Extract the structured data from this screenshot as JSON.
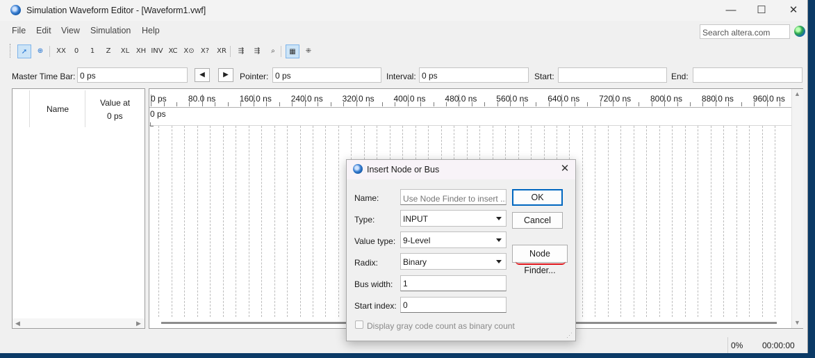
{
  "window": {
    "title": "Simulation Waveform Editor - [Waveform1.vwf]",
    "minimize_glyph": "—",
    "maximize_glyph": "☐",
    "close_glyph": "✕"
  },
  "menu": {
    "items": [
      "File",
      "Edit",
      "View",
      "Simulation",
      "Help"
    ],
    "search_placeholder": "Search altera.com"
  },
  "toolbar": {
    "buttons": [
      {
        "icon": "pointer-tool-icon",
        "glyph": "➚",
        "selected": true
      },
      {
        "icon": "zoom-tool-icon",
        "glyph": "⊕"
      },
      {
        "icon": "forcing-unknown-icon",
        "glyph": "XX"
      },
      {
        "icon": "forcing-low-icon",
        "glyph": "0"
      },
      {
        "icon": "forcing-high-icon",
        "glyph": "1"
      },
      {
        "icon": "high-impedance-icon",
        "glyph": "Z"
      },
      {
        "icon": "weak-low-icon",
        "glyph": "XL"
      },
      {
        "icon": "weak-high-icon",
        "glyph": "XH"
      },
      {
        "icon": "invert-icon",
        "glyph": "INV"
      },
      {
        "icon": "count-value-icon",
        "glyph": "XC"
      },
      {
        "icon": "clock-icon",
        "glyph": "X⊙"
      },
      {
        "icon": "random-values-icon",
        "glyph": "X?"
      },
      {
        "icon": "arbitrary-value-icon",
        "glyph": "XR"
      },
      {
        "icon": "snap-to-grid-icon",
        "glyph": "⇶"
      },
      {
        "icon": "grid-settings-icon",
        "glyph": "⇶"
      },
      {
        "icon": "node-finder-tool-icon",
        "glyph": "⌕"
      },
      {
        "icon": "timebar-toggle-icon",
        "glyph": "▦",
        "selected": true
      },
      {
        "icon": "group-icon",
        "glyph": "⁜"
      }
    ]
  },
  "timebar": {
    "master_label": "Master Time Bar:",
    "master_value": "0 ps",
    "prev_glyph": "◀",
    "next_glyph": "▶",
    "pointer_label": "Pointer:",
    "pointer_value": "0 ps",
    "interval_label": "Interval:",
    "interval_value": "0 ps",
    "start_label": "Start:",
    "start_value": "",
    "end_label": "End:",
    "end_value": ""
  },
  "node_table": {
    "name_header": "Name",
    "value_header": "Value at",
    "value_time": "0 ps"
  },
  "waveform": {
    "ticks": [
      "0 ps",
      "80.0 ns",
      "160.0 ns",
      "240.0 ns",
      "320.0 ns",
      "400.0 ns",
      "480.0 ns",
      "560.0 ns",
      "640.0 ns",
      "720.0 ns",
      "800.0 ns",
      "880.0 ns",
      "960.0 ns"
    ],
    "cursor_label": "0 ps"
  },
  "status": {
    "progress": "0%",
    "elapsed": "00:00:00"
  },
  "dialog": {
    "title": "Insert Node or Bus",
    "close_glyph": "✕",
    "name_label": "Name:",
    "name_value": "",
    "name_placeholder": "Use Node Finder to insert ...",
    "type_label": "Type:",
    "type_value": "INPUT",
    "value_type_label": "Value type:",
    "value_type_value": "9-Level",
    "radix_label": "Radix:",
    "radix_value": "Binary",
    "bus_width_label": "Bus width:",
    "bus_width_value": "1",
    "start_index_label": "Start index:",
    "start_index_value": "0",
    "ok_label": "OK",
    "cancel_label": "Cancel",
    "node_finder_label": "Node Finder...",
    "gray_code_label": "Display gray code count as binary count",
    "gray_code_checked": false,
    "annotation_color": "#e0141a"
  },
  "colors": {
    "accent": "#0067c0",
    "desktop": "#0b3a66"
  }
}
